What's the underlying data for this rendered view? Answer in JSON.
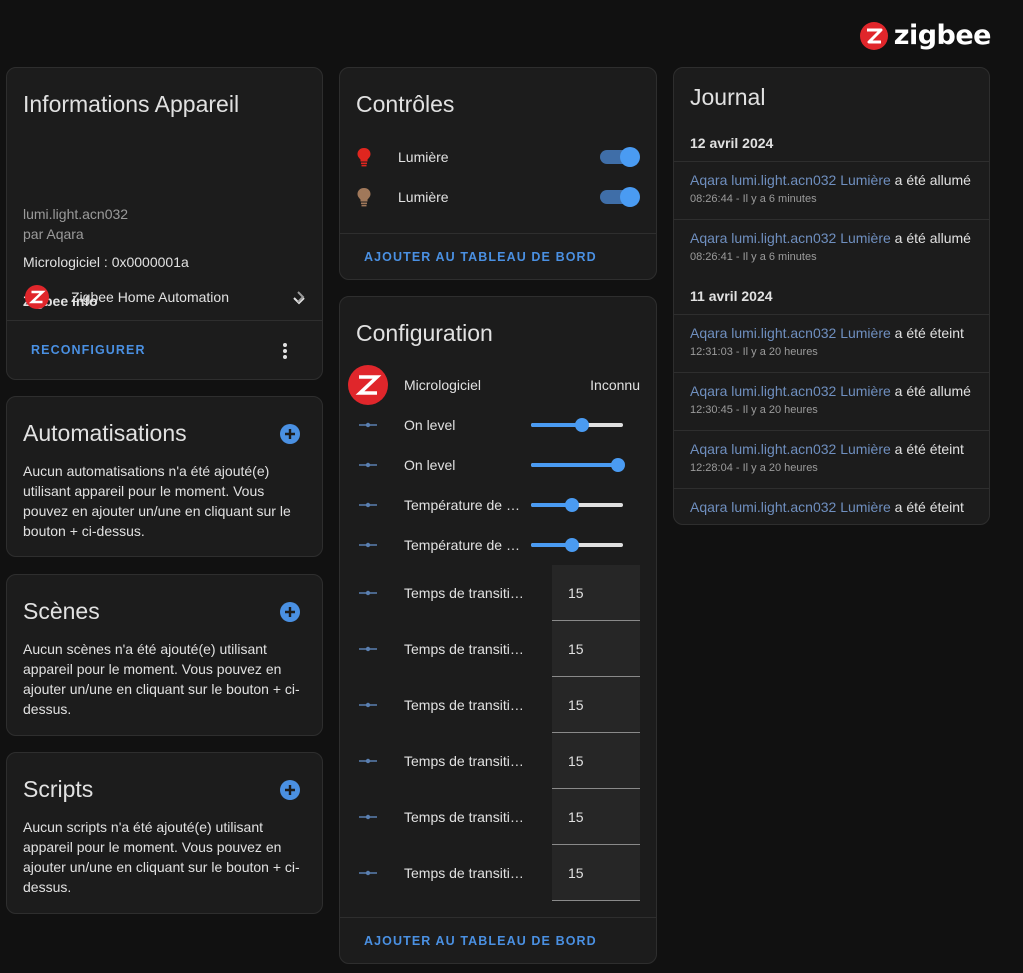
{
  "brand": {
    "name": "zigbee",
    "logo_color": "#e0262b"
  },
  "device_info": {
    "title": "Informations Appareil",
    "model": "lumi.light.acn032",
    "manufacturer": "par Aqara",
    "firmware": "Micrologiciel : 0x0000001a",
    "zigbee_info_label": "Zigbee info",
    "integration_label": "Zigbee Home Automation",
    "reconfigure_label": "RECONFIGURER"
  },
  "automations": {
    "title": "Automatisations",
    "description": "Aucun automatisations n'a été ajouté(e) utilisant appareil pour le moment. Vous pouvez en ajouter un/une en cliquant sur le bouton + ci-dessus."
  },
  "scenes": {
    "title": "Scènes",
    "description": "Aucun scènes n'a été ajouté(e) utilisant appareil pour le moment. Vous pouvez en ajouter un/une en cliquant sur le bouton + ci-dessus."
  },
  "scripts": {
    "title": "Scripts",
    "description": "Aucun scripts n'a été ajouté(e) utilisant appareil pour le moment. Vous pouvez en ajouter un/une en cliquant sur le bouton + ci-dessus."
  },
  "controls": {
    "title": "Contrôles",
    "items": [
      {
        "label": "Lumière",
        "icon": "bulb-red-icon",
        "icon_color": "#e0261f",
        "state": "on"
      },
      {
        "label": "Lumière",
        "icon": "bulb-brown-icon",
        "icon_color": "#a0785a",
        "state": "on"
      }
    ],
    "add_label": "AJOUTER AU TABLEAU DE BORD"
  },
  "configuration": {
    "title": "Configuration",
    "firmware": {
      "label": "Micrologiciel",
      "value": "Inconnu"
    },
    "sliders": [
      {
        "label": "On level",
        "level": 0.55
      },
      {
        "label": "On level",
        "level": 0.95
      },
      {
        "label": "Température de couleur",
        "level": 0.45
      },
      {
        "label": "Température de couleur",
        "level": 0.45
      }
    ],
    "numbers": [
      {
        "label": "Temps de transition",
        "value": "15"
      },
      {
        "label": "Temps de transition",
        "value": "15"
      },
      {
        "label": "Temps de transition",
        "value": "15"
      },
      {
        "label": "Temps de transition",
        "value": "15"
      },
      {
        "label": "Temps de transition",
        "value": "15"
      },
      {
        "label": "Temps de transition",
        "value": "15"
      }
    ],
    "add_label": "AJOUTER AU TABLEAU DE BORD"
  },
  "journal": {
    "title": "Journal",
    "dates": [
      "12 avril 2024",
      "11 avril 2024"
    ],
    "entries": [
      {
        "entity": "Aqara lumi.light.acn032 Lumière",
        "action": " a été allumé",
        "time": "08:26:44 - Il y a 6 minutes"
      },
      {
        "entity": "Aqara lumi.light.acn032 Lumière",
        "action": " a été allumé",
        "time": "08:26:41 - Il y a 6 minutes"
      },
      {
        "entity": "Aqara lumi.light.acn032 Lumière",
        "action": " a été éteint",
        "time": "12:31:03 - Il y a 20 heures"
      },
      {
        "entity": "Aqara lumi.light.acn032 Lumière",
        "action": " a été allumé",
        "time": "12:30:45 - Il y a 20 heures"
      },
      {
        "entity": "Aqara lumi.light.acn032 Lumière",
        "action": " a été éteint",
        "time": "12:28:04 - Il y a 20 heures"
      },
      {
        "entity": "Aqara lumi.light.acn032 Lumière",
        "action": " a été éteint",
        "time": ""
      }
    ]
  }
}
